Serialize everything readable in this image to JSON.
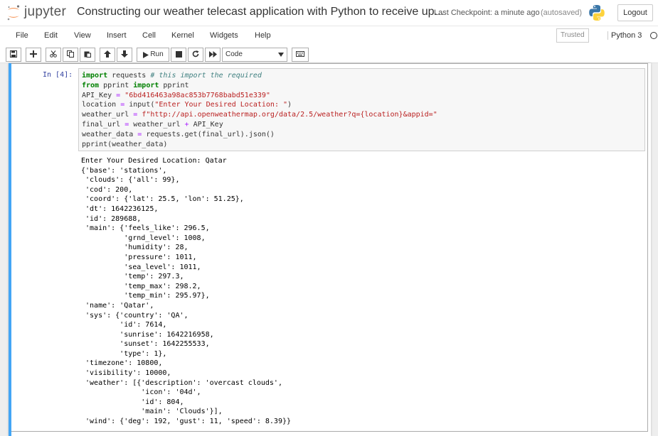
{
  "header": {
    "logo_text": "jupyter",
    "notebook_title": "Constructing our weather telecast application with Python to receive up...",
    "checkpoint": "Last Checkpoint: a minute ago",
    "autosaved": "(autosaved)",
    "logout_label": "Logout"
  },
  "menubar": {
    "items": [
      "File",
      "Edit",
      "View",
      "Insert",
      "Cell",
      "Kernel",
      "Widgets",
      "Help"
    ],
    "trusted": "Trusted",
    "kernel": "Python 3"
  },
  "toolbar": {
    "run_label": "Run",
    "cell_type": "Code"
  },
  "cell": {
    "prompt": "In [4]:",
    "code": [
      [
        {
          "t": "import",
          "c": "kw"
        },
        {
          "t": " requests ",
          "c": ""
        },
        {
          "t": "# this import the required",
          "c": "cm"
        }
      ],
      [
        {
          "t": "from",
          "c": "kw"
        },
        {
          "t": " pprint ",
          "c": ""
        },
        {
          "t": "import",
          "c": "kw"
        },
        {
          "t": " pprint",
          "c": ""
        }
      ],
      [
        {
          "t": "API_Key ",
          "c": ""
        },
        {
          "t": "=",
          "c": "op"
        },
        {
          "t": " ",
          "c": ""
        },
        {
          "t": "\"6bd416463a98ac853b7768babd51e339\"",
          "c": "st"
        }
      ],
      [
        {
          "t": "location ",
          "c": ""
        },
        {
          "t": "=",
          "c": "op"
        },
        {
          "t": " input(",
          "c": ""
        },
        {
          "t": "\"Enter Your Desired Location: \"",
          "c": "st"
        },
        {
          "t": ")",
          "c": ""
        }
      ],
      [
        {
          "t": "weather_url ",
          "c": ""
        },
        {
          "t": "=",
          "c": "op"
        },
        {
          "t": " ",
          "c": ""
        },
        {
          "t": "f\"http://api.openweathermap.org/data/2.5/weather?q={location}&appid=\"",
          "c": "st"
        }
      ],
      [
        {
          "t": "final_url ",
          "c": ""
        },
        {
          "t": "=",
          "c": "op"
        },
        {
          "t": " weather_url ",
          "c": ""
        },
        {
          "t": "+",
          "c": "op"
        },
        {
          "t": " API_Key",
          "c": ""
        }
      ],
      [
        {
          "t": "weather_data ",
          "c": ""
        },
        {
          "t": "=",
          "c": "op"
        },
        {
          "t": " requests.get(final_url).json()",
          "c": ""
        }
      ],
      [
        {
          "t": "pprint(weather_data)",
          "c": ""
        }
      ]
    ],
    "output": [
      "Enter Your Desired Location: Qatar",
      "{'base': 'stations',",
      " 'clouds': {'all': 99},",
      " 'cod': 200,",
      " 'coord': {'lat': 25.5, 'lon': 51.25},",
      " 'dt': 1642236125,",
      " 'id': 289688,",
      " 'main': {'feels_like': 296.5,",
      "          'grnd_level': 1008,",
      "          'humidity': 28,",
      "          'pressure': 1011,",
      "          'sea_level': 1011,",
      "          'temp': 297.3,",
      "          'temp_max': 298.2,",
      "          'temp_min': 295.97},",
      " 'name': 'Qatar',",
      " 'sys': {'country': 'QA',",
      "         'id': 7614,",
      "         'sunrise': 1642216958,",
      "         'sunset': 1642255533,",
      "         'type': 1},",
      " 'timezone': 10800,",
      " 'visibility': 10000,",
      " 'weather': [{'description': 'overcast clouds',",
      "              'icon': '04d',",
      "              'id': 804,",
      "              'main': 'Clouds'}],",
      " 'wind': {'deg': 192, 'gust': 11, 'speed': 8.39}}"
    ]
  },
  "colors": {
    "accent": "#f37626",
    "cell_selected_bar": "#42a5f5",
    "prompt": "#303f9f"
  }
}
